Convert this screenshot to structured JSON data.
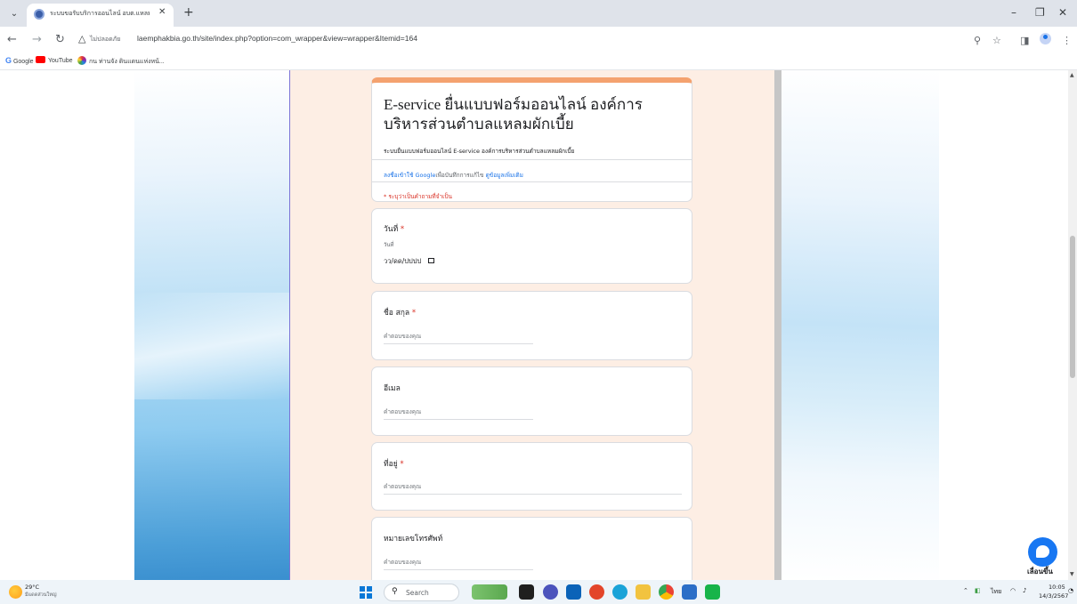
{
  "browser": {
    "tab_title": "ระบบขอรับบริการออนไลน์ อบต.แหลม",
    "tab_close": "✕",
    "new_tab": "+",
    "not_secure_label": "ไม่ปลอดภัย",
    "url": "laemphakbia.go.th/site/index.php?option=com_wrapper&view=wrapper&Itemid=164",
    "bookmarks": [
      {
        "label": "Google"
      },
      {
        "label": "YouTube"
      },
      {
        "label": "กน ท่านจัง ดินแดนแห่งหน้..."
      }
    ]
  },
  "form": {
    "title": "E-service ยื่นแบบฟอร์มออนไลน์ องค์การบริหารส่วนตำบลแหลมผักเบี้ย",
    "description": "ระบบยื่นแบบฟอร์มออนไลน์ E-service องค์การบริหารส่วนตำบลแหลมผักเบี้ย",
    "signin_link": "ลงชื่อเข้าใช้ Google",
    "signin_rest": "เพื่อบันทึกการแก้ไข",
    "learn_more": "ดูข้อมูลเพิ่มเติม",
    "required_note": "* ระบุว่าเป็นคำถามที่จำเป็น",
    "questions": [
      {
        "label": "วันที่",
        "required": "*",
        "sublabel": "วันที่",
        "placeholder": "วว/ดด/ปปปป"
      },
      {
        "label": "ชื่อ สกุล",
        "required": "*",
        "placeholder": "คำตอบของคุณ"
      },
      {
        "label": "อีเมล",
        "placeholder": "คำตอบของคุณ"
      },
      {
        "label": "ที่อยู่",
        "required": "*",
        "placeholder": "คำตอบของคุณ"
      },
      {
        "label": "หมายเลขโทรศัพท์",
        "placeholder": "คำตอบของคุณ"
      }
    ]
  },
  "messenger": {
    "label": "เลื่อนขึ้น"
  },
  "taskbar": {
    "weather_temp": "29°C",
    "weather_desc": "มีแดดส่วนใหญ่",
    "search_placeholder": "Search",
    "language": "ไทย",
    "time": "10:05",
    "date": "14/3/2567"
  }
}
